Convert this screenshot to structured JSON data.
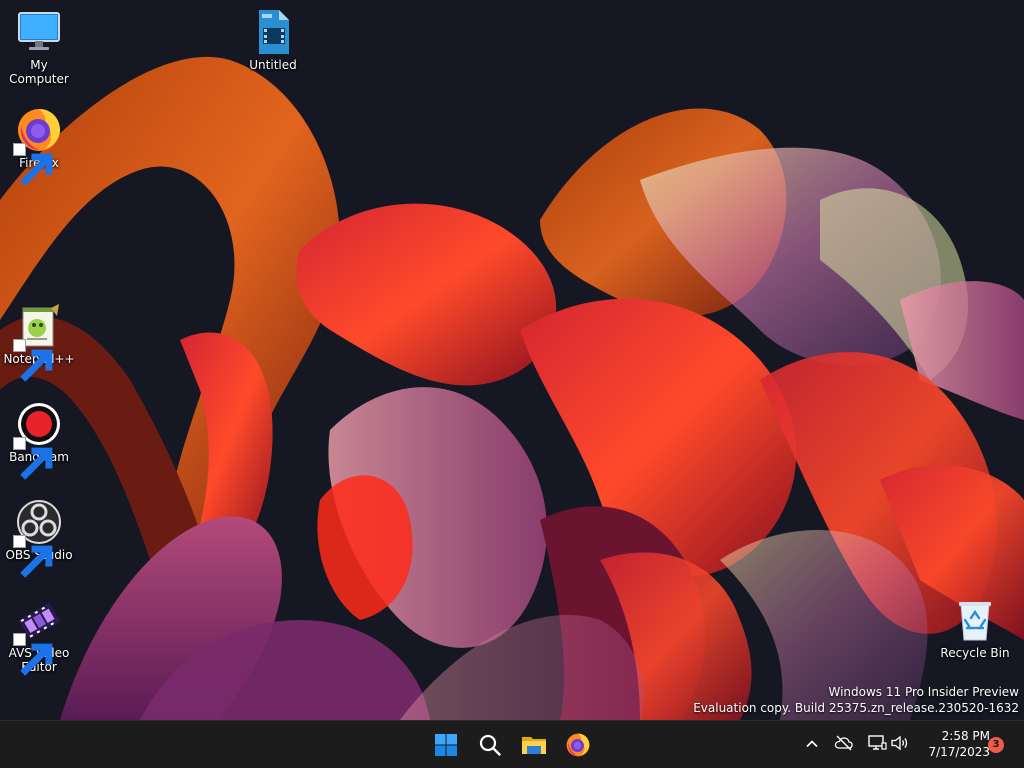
{
  "desktop": {
    "icons": [
      {
        "label": "My Computer"
      },
      {
        "label": "Untitled"
      },
      {
        "label": "Firefox"
      },
      {
        "label": "Notepad++"
      },
      {
        "label": "Bandicam"
      },
      {
        "label": "OBS Studio"
      },
      {
        "label": "AVS Video Editor"
      },
      {
        "label": "Recycle Bin"
      }
    ],
    "watermark": {
      "line1": "Windows 11 Pro Insider Preview",
      "line2": "Evaluation copy. Build 25375.zn_release.230520-1632"
    }
  },
  "taskbar": {
    "buttons": [
      {
        "icon": "windows-start-icon"
      },
      {
        "icon": "search-icon"
      },
      {
        "icon": "file-explorer-icon"
      },
      {
        "icon": "firefox-icon"
      }
    ],
    "tray": {
      "icons": [
        "chevron-up-icon",
        "cloud-off-icon",
        "network-icon",
        "speaker-icon"
      ],
      "time": "2:58 PM",
      "date": "7/17/2023",
      "notification_count": "3"
    }
  },
  "colors": {
    "taskbar_bg": "#1c1c1c",
    "desktop_bg": "#151722",
    "accent": "#0078d4",
    "badge": "#f25a4a"
  }
}
